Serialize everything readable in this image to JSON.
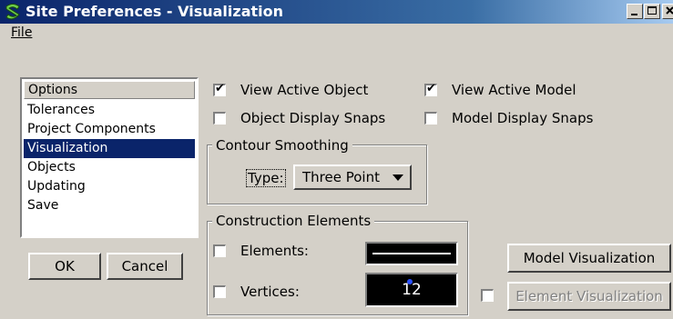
{
  "window": {
    "title": "Site Preferences - Visualization"
  },
  "menu": {
    "file": "File"
  },
  "options_list": {
    "header": "Options",
    "items": [
      "Tolerances",
      "Project Components",
      "Visualization",
      "Objects",
      "Updating",
      "Save"
    ],
    "selected": "Visualization"
  },
  "dialog_buttons": {
    "ok": "OK",
    "cancel": "Cancel"
  },
  "checkboxes": {
    "view_active_object": {
      "label": "View Active Object",
      "checked": true
    },
    "view_active_model": {
      "label": "View Active Model",
      "checked": true
    },
    "object_display_snaps": {
      "label": "Object Display Snaps",
      "checked": false
    },
    "model_display_snaps": {
      "label": "Model Display Snaps",
      "checked": false
    }
  },
  "contour_smoothing": {
    "title": "Contour Smoothing",
    "type_label": "Type:",
    "type_value": "Three Point"
  },
  "construction_elements": {
    "title": "Construction Elements",
    "elements_label": "Elements:",
    "elements_checked": false,
    "vertices_label": "Vertices:",
    "vertices_checked": false,
    "vertices_value": "12"
  },
  "visualization_buttons": {
    "model": "Model Visualization",
    "element": "Element Visualization",
    "element_enabled": false,
    "element_checkbox_checked": false
  },
  "colors": {
    "title_start": "#0a246a",
    "selection": "#0a246a",
    "face": "#d4d0c8",
    "vertex_dot": "#2a50ff"
  }
}
